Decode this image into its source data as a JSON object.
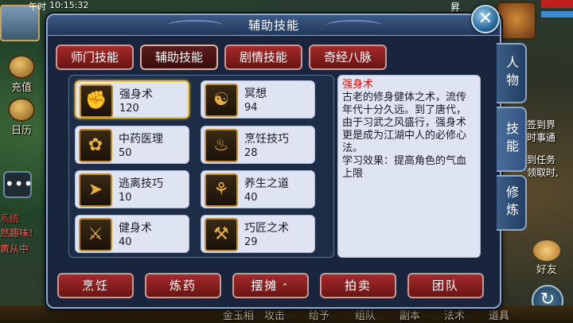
{
  "hud": {
    "time_label": "午时",
    "clock": "10:15:32",
    "right_top_label": "昇",
    "left_buttons": [
      {
        "label": "充值",
        "icon": "recharge-icon"
      },
      {
        "label": "日历",
        "icon": "calendar-icon"
      }
    ],
    "chat_lines": [
      {
        "text": "系统",
        "color": "#e04040"
      },
      {
        "text": "然趣味！",
        "color": "#ff5a5a"
      },
      {
        "text": "黄从中",
        "color": "#ff5a5a"
      }
    ],
    "right_texts": [
      "签到界",
      "时事通",
      "到任务",
      "领取时,"
    ],
    "friend_label": "好友",
    "bottom_items": [
      "金玉相",
      "攻击",
      "给予",
      "组队",
      "副本",
      "法术",
      "道具"
    ]
  },
  "panel": {
    "title": "辅助技能",
    "close_symbol": "✕",
    "tabs": [
      "师门技能",
      "辅助技能",
      "剧情技能",
      "奇经八脉"
    ],
    "active_tab": 1,
    "side_tabs": [
      "人物",
      "技能",
      "修炼"
    ],
    "active_side_tab": 1,
    "skills": [
      {
        "name": "强身术",
        "level": "120",
        "icon": "fist-icon"
      },
      {
        "name": "冥想",
        "level": "94",
        "icon": "meditate-icon"
      },
      {
        "name": "中药医理",
        "level": "50",
        "icon": "herb-icon"
      },
      {
        "name": "烹饪技巧",
        "level": "28",
        "icon": "cooking-icon"
      },
      {
        "name": "逃离技巧",
        "level": "10",
        "icon": "escape-icon"
      },
      {
        "name": "养生之道",
        "level": "40",
        "icon": "wellness-icon"
      },
      {
        "name": "健身术",
        "level": "40",
        "icon": "fitness-icon"
      },
      {
        "name": "巧匠之术",
        "level": "29",
        "icon": "craft-icon"
      }
    ],
    "selected_skill": 0,
    "description": {
      "title": "强身术",
      "body": "古老的修身健体之术，流传年代十分久远。到了唐代，由于习武之风盛行，强身术更是成为江湖中人的必修心法。",
      "effect": "学习效果：提高角色的气血上限"
    },
    "bottom_buttons": [
      {
        "label": "烹饪"
      },
      {
        "label": "炼药"
      },
      {
        "label": "摆摊",
        "has_chevron": true
      },
      {
        "label": "拍卖"
      },
      {
        "label": "团队"
      }
    ]
  },
  "colors": {
    "button_red": "#a32a2a",
    "panel_blue": "#18253c",
    "highlight_gold": "#e8c040",
    "desc_title_red": "#d01818"
  }
}
